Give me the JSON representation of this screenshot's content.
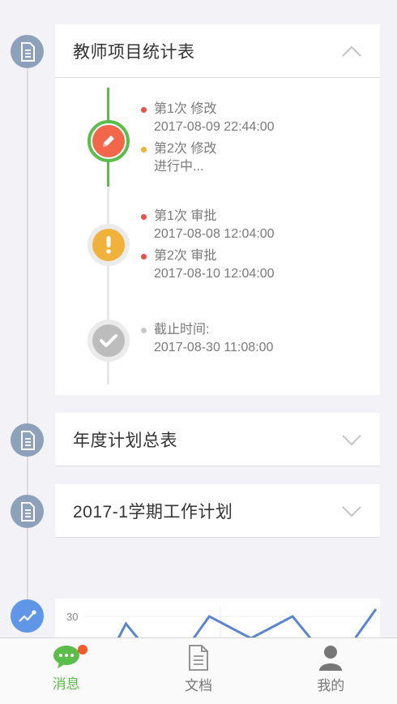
{
  "sections": [
    {
      "title": "教师项目统计表",
      "expanded": true,
      "groups": [
        {
          "status": "edit",
          "color": "#f2664a",
          "entries": [
            {
              "label": "第1次 修改",
              "detail": "2017-08-09 22:44:00",
              "dot_color": "#e8524a"
            },
            {
              "label": "第2次 修改",
              "detail": "进行中...",
              "dot_color": "#f0b030"
            }
          ]
        },
        {
          "status": "warning",
          "color": "#f0b23a",
          "entries": [
            {
              "label": "第1次 审批",
              "detail": "2017-08-08 12:04:00",
              "dot_color": "#e8524a"
            },
            {
              "label": "第2次 审批",
              "detail": "2017-08-10 12:04:00",
              "dot_color": "#e8524a"
            }
          ]
        },
        {
          "status": "done",
          "color": "#bdbdbd",
          "entries": [
            {
              "label": "截止时间:",
              "detail": "2017-08-30 11:08:00",
              "dot_color": "#c8c8c8"
            }
          ]
        }
      ]
    },
    {
      "title": "年度计划总表",
      "expanded": false
    },
    {
      "title": "2017-1学期工作计划",
      "expanded": false
    }
  ],
  "chart_data": {
    "type": "line",
    "tick_labels": [
      "30"
    ],
    "series": [
      {
        "values": [
          18,
          29,
          22,
          30,
          27,
          30,
          23,
          31
        ]
      }
    ],
    "color": "#5b86cf"
  },
  "tabs": [
    {
      "label": "消息",
      "icon": "chat-bubble-icon",
      "active": true,
      "has_badge": true
    },
    {
      "label": "文档",
      "icon": "document-icon",
      "active": false,
      "has_badge": false
    },
    {
      "label": "我的",
      "icon": "person-icon",
      "active": false,
      "has_badge": false
    }
  ],
  "colors": {
    "accent_green": "#5bbd4a",
    "badge_blue_gray": "#8ea1ba",
    "chart_badge_blue": "#5f96e8",
    "notification_red": "#f05a28"
  }
}
